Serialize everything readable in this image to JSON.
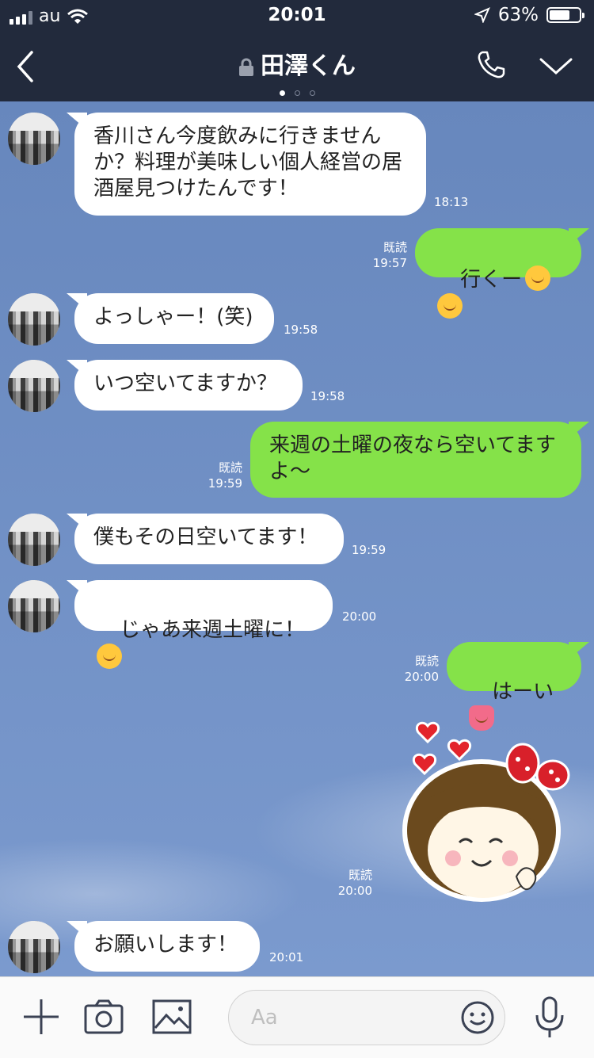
{
  "status_bar": {
    "carrier": "au",
    "time": "20:01",
    "battery": "63%"
  },
  "header": {
    "title": "田澤くん",
    "page_dots": 3,
    "active_dot": 0
  },
  "messages": [
    {
      "side": "in",
      "text": "香川さん今度飲みに行きません\nか？料理が美味しい個人経営の居\n酒屋見つけたんです！",
      "time": "18:13"
    },
    {
      "side": "out",
      "text": "行くー",
      "read": "既読",
      "time": "19:57",
      "emoji": [
        "smile-emoji",
        "smile-emoji"
      ]
    },
    {
      "side": "in",
      "text": "よっしゃー！(笑)",
      "time": "19:58"
    },
    {
      "side": "in",
      "text": "いつ空いてますか？",
      "time": "19:58"
    },
    {
      "side": "out",
      "text": "来週の土曜の夜なら空いてます\nよ〜",
      "read": "既読",
      "time": "19:59"
    },
    {
      "side": "in",
      "text": "僕もその日空いてます！",
      "time": "19:59"
    },
    {
      "side": "in",
      "text": "じゃあ来週土曜に！",
      "time": "20:00",
      "emoji": [
        "laughing-emoji"
      ]
    },
    {
      "side": "out",
      "text": "はーい",
      "read": "既読",
      "time": "20:00",
      "emoji": [
        "raising-hand-emoji"
      ]
    },
    {
      "side": "out",
      "type": "sticker",
      "read": "既読",
      "time": "20:00",
      "sticker": "girl-with-hearts-sticker"
    },
    {
      "side": "in",
      "text": "お願いします！",
      "time": "20:01"
    }
  ],
  "composer": {
    "placeholder": "Aa"
  },
  "colors": {
    "header_bg": "#222a3c",
    "outgoing_bubble": "#85e249",
    "incoming_bubble": "#ffffff",
    "chat_bg": "#6f8fc2"
  }
}
